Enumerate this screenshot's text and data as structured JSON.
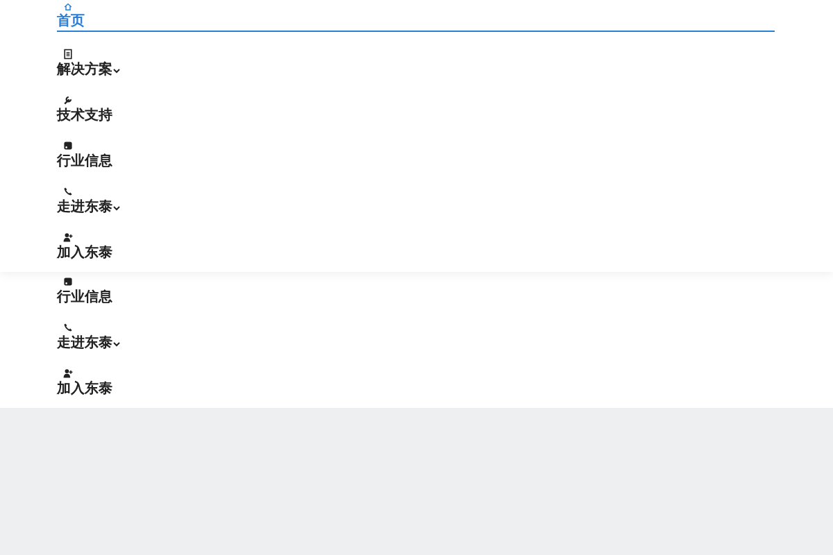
{
  "main_menu": [
    {
      "label": "首页",
      "selected": true,
      "dropdown": false
    },
    {
      "label": "解决方案",
      "selected": false,
      "dropdown": true
    },
    {
      "label": "技术支持",
      "selected": false,
      "dropdown": false
    },
    {
      "label": "行业信息",
      "selected": false,
      "dropdown": false
    },
    {
      "label": "走进东泰",
      "selected": false,
      "dropdown": true
    },
    {
      "label": "加入东泰",
      "selected": false,
      "dropdown": false
    }
  ],
  "lower_menu": [
    {
      "label": "行业信息",
      "selected": false,
      "dropdown": false
    },
    {
      "label": "走进东泰",
      "selected": false,
      "dropdown": true
    },
    {
      "label": "加入东泰",
      "selected": false,
      "dropdown": false
    }
  ]
}
